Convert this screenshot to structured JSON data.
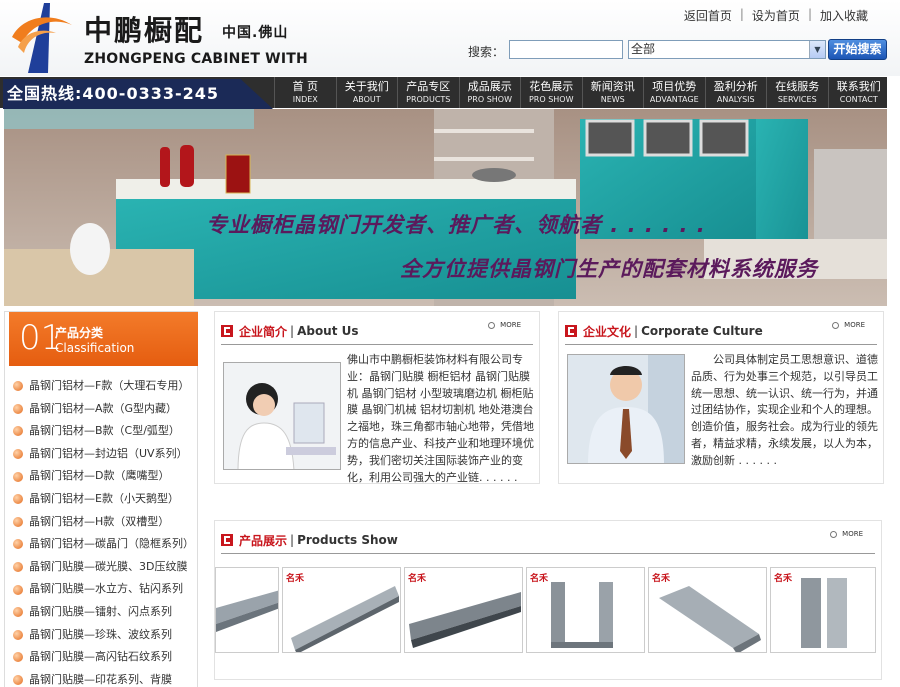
{
  "header": {
    "brand_cn": "中鹏橱配",
    "brand_place": "中国.佛山",
    "brand_en": "ZHONGPENG CABINET WITH",
    "toplinks": [
      "返回首页",
      "设为首页",
      "加入收藏"
    ],
    "search_label": "搜索：",
    "search_value": "",
    "search_select": "全部",
    "search_button": "开始搜索"
  },
  "nav": {
    "hotline": "全国热线:400-0333-245",
    "items": [
      {
        "cn": "首 页",
        "en": "INDEX"
      },
      {
        "cn": "关于我们",
        "en": "ABOUT"
      },
      {
        "cn": "产品专区",
        "en": "PRODUCTS"
      },
      {
        "cn": "成品展示",
        "en": "PRO SHOW"
      },
      {
        "cn": "花色展示",
        "en": "PRO SHOW"
      },
      {
        "cn": "新闻资讯",
        "en": "NEWS"
      },
      {
        "cn": "项目优势",
        "en": "ADVANTAGE"
      },
      {
        "cn": "盈利分析",
        "en": "ANALYSIS"
      },
      {
        "cn": "在线服务",
        "en": "SERVICES"
      },
      {
        "cn": "联系我们",
        "en": "CONTACT"
      }
    ]
  },
  "banner": {
    "line1": "专业橱柜晶钢门开发者、推广者、领航者 . . .  . . .",
    "line2": "全方位提供晶钢门生产的配套材料系统服务"
  },
  "sidebar": {
    "num": "01",
    "title_cn": "产品分类",
    "title_en": "Classification",
    "items": [
      "晶钢门铝材—F款（大理石专用）",
      "晶钢门铝材—A款（G型内藏）",
      "晶钢门铝材—B款（C型/弧型）",
      "晶钢门铝材—封边铝（UV系列）",
      "晶钢门铝材—D款（鹰嘴型）",
      "晶钢门铝材—E款（小天鹅型）",
      "晶钢门铝材—H款（双槽型）",
      "晶钢门铝材—碳晶门（隐框系列）",
      "晶钢门贴膜—碳光膜、3D压纹膜",
      "晶钢门贴膜—水立方、钻闪系列",
      "晶钢门贴膜—镭射、闪点系列",
      "晶钢门贴膜—珍珠、波纹系列",
      "晶钢门贴膜—高闪钻石纹系列",
      "晶钢门贴膜—印花系列、背膜"
    ]
  },
  "about": {
    "title_cn": "企业简介",
    "title_en": "About Us",
    "more": "MORE",
    "text": "佛山市中鹏橱柜装饰材料有限公司专业：晶钢门贴膜 橱柜铝材 晶钢门贴膜机 晶钢门铝材 小型玻璃磨边机 橱柜贴膜 晶钢门机械 铝材切割机 地处港澳台之福地，珠三角都市轴心地带，凭借地方的信息产业、科技产业和地理环境优势，我们密切关注国际装饰产业的变化，利用公司强大的产业链. . . . . ."
  },
  "culture": {
    "title_cn": "企业文化",
    "title_en": "Corporate Culture",
    "more": "MORE",
    "text": "　　公司具体制定员工思想意识、道德品质、行为处事三个规范，以引导员工统一思想、统一认识、统一行为，并通过团结协作，实现企业和个人的理想。创造价值，服务社会。成为行业的领先者，精益求精，永续发展，以人为本，激励创新 . . . . . ."
  },
  "products": {
    "title_cn": "产品展示",
    "title_en": "Products Show",
    "more": "MORE",
    "watermark": "名禾"
  }
}
